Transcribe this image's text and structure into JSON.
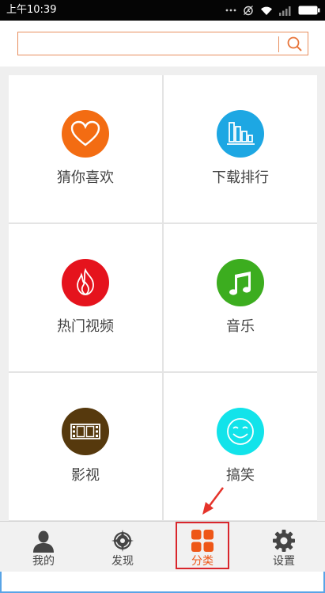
{
  "status_bar": {
    "time": "上午10:39"
  },
  "search": {
    "placeholder": "",
    "value": ""
  },
  "categories": [
    {
      "label": "猜你喜欢",
      "icon": "heart-icon",
      "color": "#f36c12"
    },
    {
      "label": "下载排行",
      "icon": "bar-chart-icon",
      "color": "#1da7e3"
    },
    {
      "label": "热门视频",
      "icon": "flame-icon",
      "color": "#e5131d"
    },
    {
      "label": "音乐",
      "icon": "music-note-icon",
      "color": "#3cad1f"
    },
    {
      "label": "影视",
      "icon": "film-strip-icon",
      "color": "#56390d"
    },
    {
      "label": "搞笑",
      "icon": "smiley-icon",
      "color": "#12e3ea"
    }
  ],
  "nav": [
    {
      "label": "我的",
      "icon": "user-icon"
    },
    {
      "label": "发现",
      "icon": "compass-icon"
    },
    {
      "label": "分类",
      "icon": "grid-icon",
      "active": true
    },
    {
      "label": "设置",
      "icon": "gear-icon"
    }
  ],
  "colors": {
    "accent": "#ee5718",
    "highlight_box": "#d9262c"
  }
}
